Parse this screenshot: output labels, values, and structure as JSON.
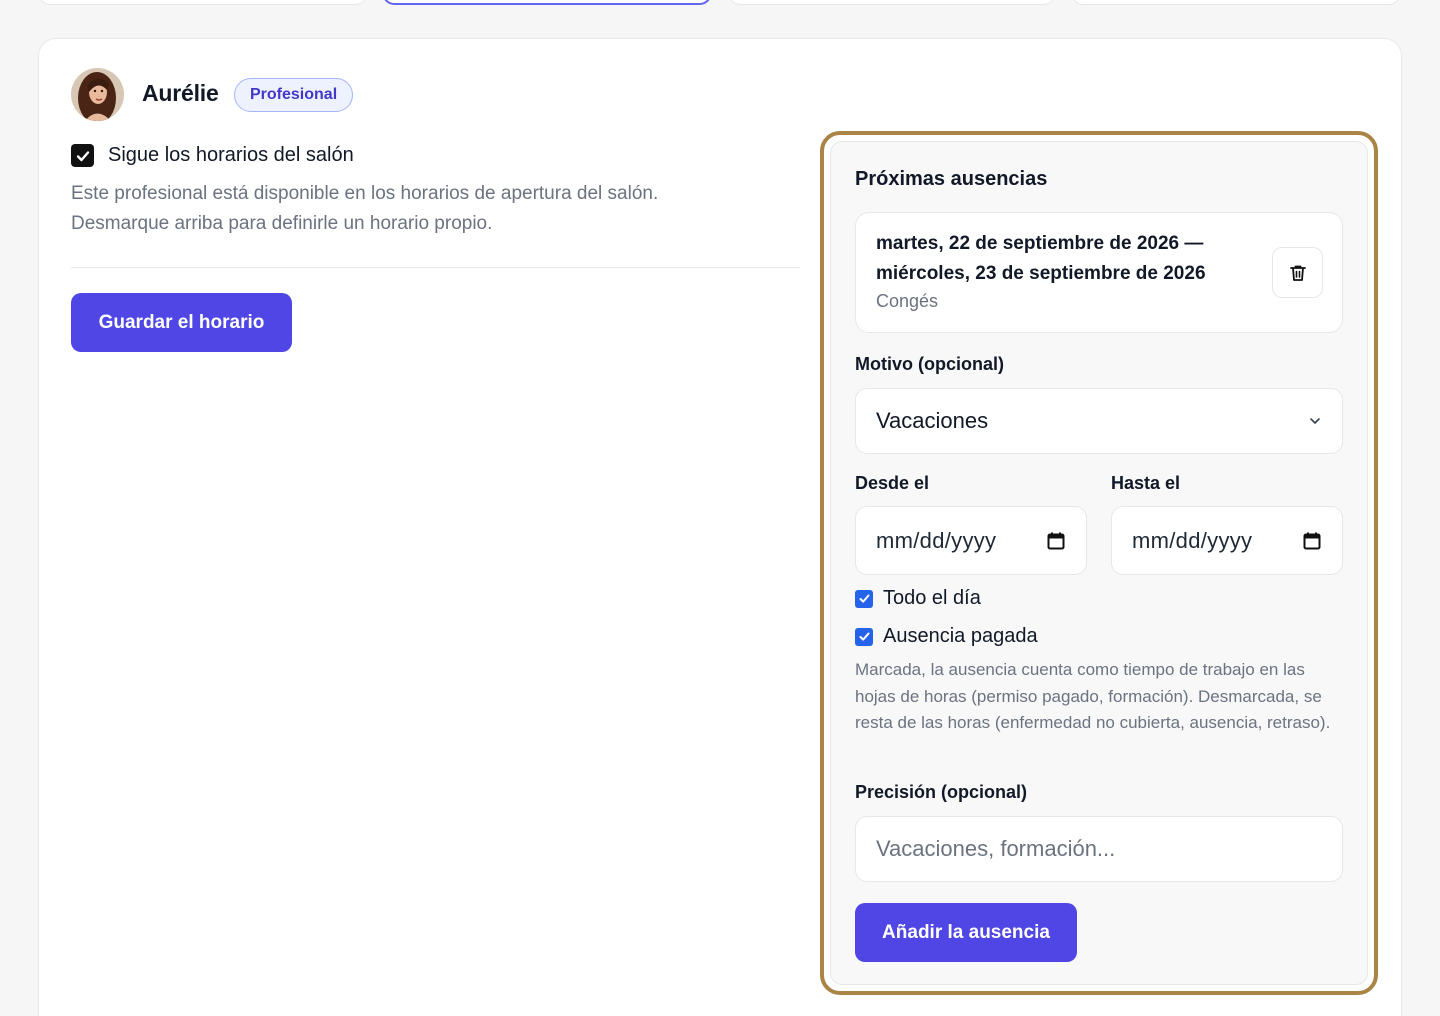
{
  "professional": {
    "name": "Aurélie",
    "role_badge": "Profesional",
    "avatar_icon": "profile-photo"
  },
  "schedule": {
    "follow_salon_label": "Sigue los horarios del salón",
    "follow_salon_checked": true,
    "help_line1": "Este profesional está disponible en los horarios de apertura del salón.",
    "help_line2": "Desmarque arriba para definirle un horario propio.",
    "save_label": "Guardar el horario"
  },
  "absences": {
    "title": "Próximas ausencias",
    "items": [
      {
        "date_start": "martes, 22 de septiembre de 2026 —",
        "date_end": "miércoles, 23 de septiembre de 2026",
        "reason": "Congés",
        "delete_icon": "trash-icon"
      }
    ]
  },
  "form": {
    "reason_label": "Motivo (opcional)",
    "reason_value": "Vacaciones",
    "from_label": "Desde el",
    "from_placeholder": "mm/dd/yyyy",
    "to_label": "Hasta el",
    "to_placeholder": "mm/dd/yyyy",
    "all_day_label": "Todo el día",
    "all_day_checked": true,
    "paid_label": "Ausencia pagada",
    "paid_checked": true,
    "paid_help": "Marcada, la ausencia cuenta como tiempo de trabajo en las hojas de horas (permiso pagado, formación). Desmarcada, se resta de las horas (enfermedad no cubierta, ausencia, retraso).",
    "precision_label": "Precisión (opcional)",
    "precision_placeholder": "Vacaciones, formación...",
    "add_label": "Añadir la ausencia"
  },
  "colors": {
    "primary": "#4f46e5",
    "checkbox_blue": "#2563eb",
    "highlight_border": "#a98444",
    "badge_text": "#4338ca"
  }
}
